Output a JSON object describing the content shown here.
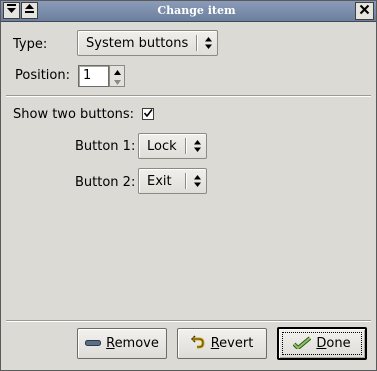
{
  "window": {
    "title": "Change item",
    "menu_icon": "menu-arrow-icon",
    "shade_icon": "shade-icon",
    "close_icon": "close-icon"
  },
  "form": {
    "type_label": "Type:",
    "type_value": "System buttons",
    "position_label": "Position:",
    "position_value": "1",
    "show_two_label": "Show two buttons:",
    "show_two_checked": true,
    "button1_label": "Button 1:",
    "button1_value": "Lock",
    "button2_label": "Button 2:",
    "button2_value": "Exit"
  },
  "actions": {
    "remove_mnemonic": "R",
    "remove_rest": "emove",
    "revert_mnemonic": "R",
    "revert_rest": "evert",
    "done_mnemonic": "D",
    "done_rest": "one"
  }
}
